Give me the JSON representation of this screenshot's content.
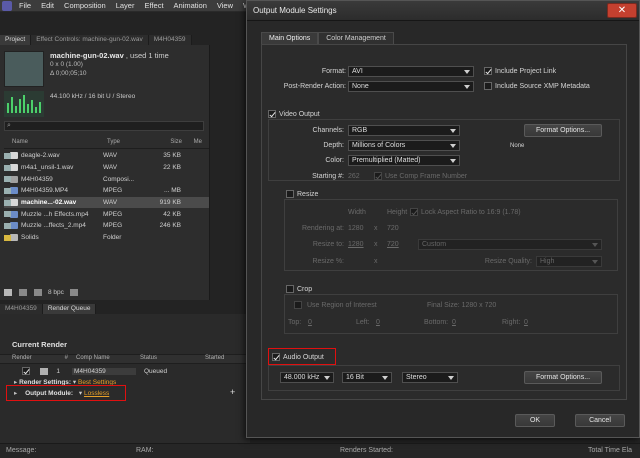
{
  "colors": {
    "accent_red": "#e01010",
    "link_orange": "#e8a028",
    "dialog_bg": "#282828",
    "close_red": "#c4402f"
  },
  "menubar": {
    "items": [
      "File",
      "Edit",
      "Composition",
      "Layer",
      "Effect",
      "Animation",
      "View",
      "Win"
    ]
  },
  "project": {
    "tabs": [
      "Project",
      "Effect Controls: machine-gun-02.wav",
      "M4H04359"
    ],
    "selected_name": "machine-gun-02.wav",
    "used": ", used 1 time",
    "dims": "0 x 0 (1.00)",
    "duration": "Δ 0;00;05;10",
    "audio_info": "44.100 kHz / 16 bit U / Stereo",
    "search_icon": "search-icon",
    "columns": [
      "Name",
      "Type",
      "Size",
      "Me"
    ],
    "files": [
      {
        "name": "deagle-2.wav",
        "type": "WAV",
        "size": "35 KB",
        "icon": "audio",
        "label": "#9ab0b0"
      },
      {
        "name": "m4a1_unsil-1.wav",
        "type": "WAV",
        "size": "22 KB",
        "icon": "audio",
        "label": "#9ab0b0"
      },
      {
        "name": "M4H04359",
        "type": "Composi...",
        "size": "",
        "icon": "comp",
        "label": "#9ab0b0"
      },
      {
        "name": "M4H04359.MP4",
        "type": "MPEG",
        "size": "... MB",
        "icon": "video",
        "label": "#9ab0b0"
      },
      {
        "name": "machine...-02.wav",
        "type": "WAV",
        "size": "919 KB",
        "icon": "audio",
        "label": "#9ab0b0",
        "selected": true
      },
      {
        "name": "Muzzle ...h Effects.mp4",
        "type": "MPEG",
        "size": "42 KB",
        "icon": "video",
        "label": "#9ab0b0"
      },
      {
        "name": "Muzzle ...ffects_2.mp4",
        "type": "MPEG",
        "size": "246 KB",
        "icon": "video",
        "label": "#9ab0b0"
      },
      {
        "name": "Solids",
        "type": "Folder",
        "size": "",
        "icon": "folder",
        "label": "#d8b840"
      }
    ],
    "bpc": "8 bpc"
  },
  "render_queue": {
    "tabs": [
      "M4H04359",
      "Render Queue"
    ],
    "current_render": "Current Render",
    "columns": [
      "Render",
      "#",
      "Comp Name",
      "Status",
      "Started"
    ],
    "row": {
      "num": "1",
      "comp": "M4H04359",
      "status": "Queued"
    },
    "render_settings_label": "Render Settings:",
    "render_settings_value": "Best Settings",
    "output_module_label": "Output Module:",
    "output_module_value": "Lossless"
  },
  "statusbar": {
    "message": "Message:",
    "ram": "RAM:",
    "renders_started": "Renders Started:",
    "total_time": "Total Time Ela"
  },
  "dialog": {
    "title": "Output Module Settings",
    "close_icon": "close-icon",
    "tabs": [
      "Main Options",
      "Color Management"
    ],
    "format_label": "Format:",
    "format_value": "AVI",
    "include_project_link": "Include Project Link",
    "post_render_label": "Post-Render Action:",
    "post_render_value": "None",
    "include_xmp": "Include Source XMP Metadata",
    "video_output": "Video Output",
    "channels_label": "Channels:",
    "channels_value": "RGB",
    "format_options": "Format Options...",
    "depth_label": "Depth:",
    "depth_value": "Millions of Colors",
    "codec_none": "None",
    "color_label": "Color:",
    "color_value": "Premultiplied (Matted)",
    "starting_label": "Starting #:",
    "starting_value": "262",
    "use_comp_frame": "Use Comp Frame Number",
    "resize": "Resize",
    "width_label": "Width",
    "height_label": "Height",
    "lock_aspect": "Lock Aspect Ratio to 16:9 (1.78)",
    "rendering_at": "Rendering at:",
    "rendering_w": "1280",
    "rendering_h": "720",
    "resize_to": "Resize to:",
    "resize_w": "1280",
    "resize_h": "720",
    "resize_preset": "Custom",
    "resize_pct": "Resize %:",
    "resize_quality": "Resize Quality:",
    "resize_quality_value": "High",
    "crop": "Crop",
    "use_roi": "Use Region of Interest",
    "final_size": "Final Size: 1280 x 720",
    "top": "Top:",
    "top_v": "0",
    "left": "Left:",
    "left_v": "0",
    "bottom": "Bottom:",
    "bottom_v": "0",
    "right": "Right:",
    "right_v": "0",
    "x_sep": "x",
    "audio_output": "Audio Output",
    "sample_rate": "48.000 kHz",
    "bit_depth": "16 Bit",
    "channels_audio": "Stereo",
    "audio_format_options": "Format Options...",
    "ok": "OK",
    "cancel": "Cancel"
  }
}
